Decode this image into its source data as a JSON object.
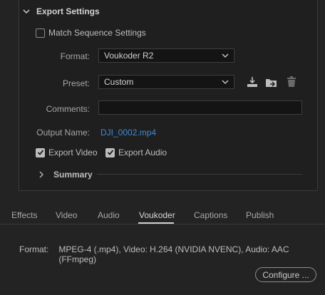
{
  "export_settings": {
    "section_title": "Export Settings",
    "match_sequence_label": "Match Sequence Settings",
    "match_sequence_checked": false,
    "format_label": "Format:",
    "format_value": "Voukoder R2",
    "preset_label": "Preset:",
    "preset_value": "Custom",
    "comments_label": "Comments:",
    "comments_value": "",
    "output_name_label": "Output Name:",
    "output_name_value": "DJI_0002.mp4",
    "export_video_label": "Export Video",
    "export_video_checked": true,
    "export_audio_label": "Export Audio",
    "export_audio_checked": true,
    "summary_label": "Summary",
    "icons": {
      "save_preset": "save-preset-icon",
      "import_preset": "import-preset-icon",
      "delete_preset": "trash-icon"
    }
  },
  "tabs": [
    {
      "label": "Effects",
      "active": false
    },
    {
      "label": "Video",
      "active": false
    },
    {
      "label": "Audio",
      "active": false
    },
    {
      "label": "Voukoder",
      "active": true
    },
    {
      "label": "Captions",
      "active": false
    },
    {
      "label": "Publish",
      "active": false
    }
  ],
  "voukoder": {
    "format_label": "Format:",
    "format_info": "MPEG-4 (.mp4), Video: H.264 (NVIDIA NVENC), Audio: AAC (FFmpeg)",
    "configure_label": "Configure ..."
  },
  "colors": {
    "background": "#232323",
    "panel": "#1f1f1f",
    "link": "#3d8bd9",
    "text": "#bdbdbd"
  }
}
